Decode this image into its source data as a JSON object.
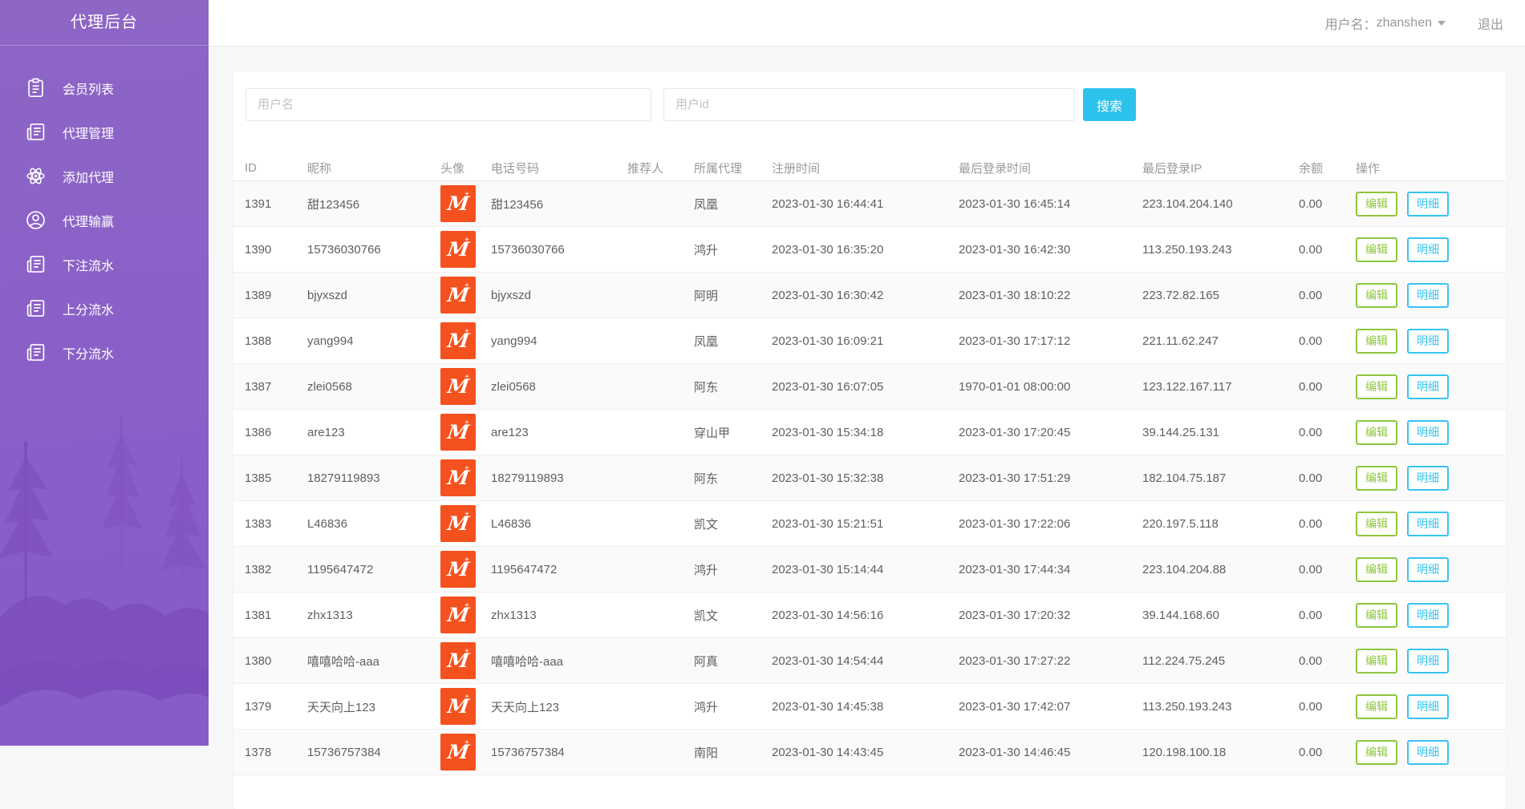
{
  "sidebar": {
    "title": "代理后台",
    "items": [
      {
        "label": "会员列表",
        "icon": "clipboard-icon"
      },
      {
        "label": "代理管理",
        "icon": "news-icon"
      },
      {
        "label": "添加代理",
        "icon": "atom-icon"
      },
      {
        "label": "代理输赢",
        "icon": "user-circle-icon"
      },
      {
        "label": "下注流水",
        "icon": "news-icon"
      },
      {
        "label": "上分流水",
        "icon": "news-icon"
      },
      {
        "label": "下分流水",
        "icon": "news-icon"
      }
    ]
  },
  "topbar": {
    "username_label": "用户名：",
    "username": "zhanshen",
    "logout_label": "退出"
  },
  "search": {
    "username_placeholder": "用户名",
    "userid_placeholder": "用户id",
    "button_label": "搜索"
  },
  "table": {
    "columns": [
      "ID",
      "昵称",
      "头像",
      "电话号码",
      "推荐人",
      "所属代理",
      "注册时间",
      "最后登录时间",
      "最后登录IP",
      "余额",
      "操作"
    ],
    "edit_label": "编辑",
    "detail_label": "明细",
    "avatar_letter": "M",
    "avatar_plus": "+",
    "rows": [
      {
        "id": "1391",
        "nickname": "甜123456",
        "phone": "甜123456",
        "referrer": "",
        "agent": "凤凰",
        "reg_time": "2023-01-30 16:44:41",
        "last_login": "2023-01-30 16:45:14",
        "last_ip": "223.104.204.140",
        "balance": "0.00"
      },
      {
        "id": "1390",
        "nickname": "15736030766",
        "phone": "15736030766",
        "referrer": "",
        "agent": "鸿升",
        "reg_time": "2023-01-30 16:35:20",
        "last_login": "2023-01-30 16:42:30",
        "last_ip": "113.250.193.243",
        "balance": "0.00"
      },
      {
        "id": "1389",
        "nickname": "bjyxszd",
        "phone": "bjyxszd",
        "referrer": "",
        "agent": "阿明",
        "reg_time": "2023-01-30 16:30:42",
        "last_login": "2023-01-30 18:10:22",
        "last_ip": "223.72.82.165",
        "balance": "0.00"
      },
      {
        "id": "1388",
        "nickname": "yang994",
        "phone": "yang994",
        "referrer": "",
        "agent": "凤凰",
        "reg_time": "2023-01-30 16:09:21",
        "last_login": "2023-01-30 17:17:12",
        "last_ip": "221.11.62.247",
        "balance": "0.00"
      },
      {
        "id": "1387",
        "nickname": "zlei0568",
        "phone": "zlei0568",
        "referrer": "",
        "agent": "阿东",
        "reg_time": "2023-01-30 16:07:05",
        "last_login": "1970-01-01 08:00:00",
        "last_ip": "123.122.167.117",
        "balance": "0.00"
      },
      {
        "id": "1386",
        "nickname": "are123",
        "phone": "are123",
        "referrer": "",
        "agent": "穿山甲",
        "reg_time": "2023-01-30 15:34:18",
        "last_login": "2023-01-30 17:20:45",
        "last_ip": "39.144.25.131",
        "balance": "0.00"
      },
      {
        "id": "1385",
        "nickname": "18279119893",
        "phone": "18279119893",
        "referrer": "",
        "agent": "阿东",
        "reg_time": "2023-01-30 15:32:38",
        "last_login": "2023-01-30 17:51:29",
        "last_ip": "182.104.75.187",
        "balance": "0.00"
      },
      {
        "id": "1383",
        "nickname": "L46836",
        "phone": "L46836",
        "referrer": "",
        "agent": "凯文",
        "reg_time": "2023-01-30 15:21:51",
        "last_login": "2023-01-30 17:22:06",
        "last_ip": "220.197.5.118",
        "balance": "0.00"
      },
      {
        "id": "1382",
        "nickname": "1195647472",
        "phone": "1195647472",
        "referrer": "",
        "agent": "鸿升",
        "reg_time": "2023-01-30 15:14:44",
        "last_login": "2023-01-30 17:44:34",
        "last_ip": "223.104.204.88",
        "balance": "0.00"
      },
      {
        "id": "1381",
        "nickname": "zhx1313",
        "phone": "zhx1313",
        "referrer": "",
        "agent": "凯文",
        "reg_time": "2023-01-30 14:56:16",
        "last_login": "2023-01-30 17:20:32",
        "last_ip": "39.144.168.60",
        "balance": "0.00"
      },
      {
        "id": "1380",
        "nickname": "嘻嘻哈哈-aaa",
        "phone": "嘻嘻哈哈-aaa",
        "referrer": "",
        "agent": "阿真",
        "reg_time": "2023-01-30 14:54:44",
        "last_login": "2023-01-30 17:27:22",
        "last_ip": "112.224.75.245",
        "balance": "0.00"
      },
      {
        "id": "1379",
        "nickname": "天天向上123",
        "phone": "天天向上123",
        "referrer": "",
        "agent": "鸿升",
        "reg_time": "2023-01-30 14:45:38",
        "last_login": "2023-01-30 17:42:07",
        "last_ip": "113.250.193.243",
        "balance": "0.00"
      },
      {
        "id": "1378",
        "nickname": "15736757384",
        "phone": "15736757384",
        "referrer": "",
        "agent": "南阳",
        "reg_time": "2023-01-30 14:43:45",
        "last_login": "2023-01-30 14:46:45",
        "last_ip": "120.198.100.18",
        "balance": "0.00"
      }
    ]
  },
  "colors": {
    "sidebar_purple": "#8a5fc8",
    "accent_cyan": "#2bc2ec",
    "edit_green": "#8ec63f",
    "detail_cyan": "#38c4ef",
    "avatar_orange": "#f4511e",
    "stripe_gray": "#fafafa"
  }
}
